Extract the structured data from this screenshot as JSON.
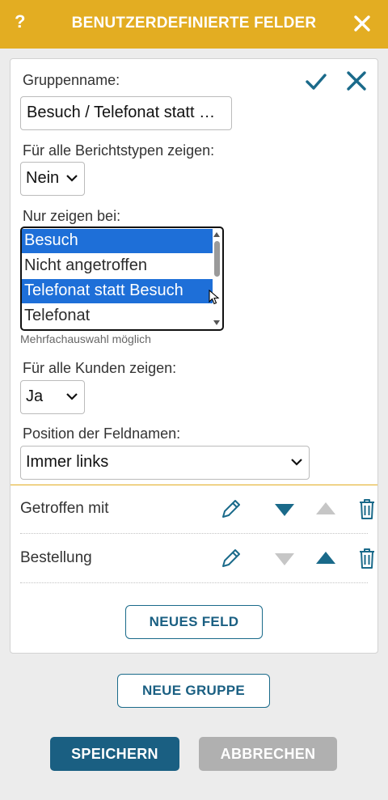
{
  "header": {
    "help_label": "?",
    "title": "BENUTZERDEFINIERTE FELDER",
    "close_icon": "close-icon"
  },
  "group": {
    "name_label": "Gruppenname:",
    "name_value": "Besuch / Telefonat statt Besuch",
    "show_all_types_label": "Für alle Berichtstypen zeigen:",
    "show_all_types_value": "Nein",
    "only_show_label": "Nur zeigen bei:",
    "only_show_options": [
      {
        "label": "Besuch",
        "selected": true
      },
      {
        "label": "Nicht angetroffen",
        "selected": false
      },
      {
        "label": "Telefonat statt Besuch",
        "selected": true
      },
      {
        "label": "Telefonat",
        "selected": false
      }
    ],
    "multi_hint": "Mehrfachauswahl möglich",
    "show_all_customers_label": "Für alle Kunden zeigen:",
    "show_all_customers_value": "Ja",
    "field_name_position_label": "Position der Feldnamen:",
    "field_name_position_value": "Immer links"
  },
  "fields": [
    {
      "name": "Getroffen mit",
      "down_enabled": true,
      "up_enabled": false
    },
    {
      "name": "Bestellung",
      "down_enabled": false,
      "up_enabled": true
    }
  ],
  "buttons": {
    "new_field": "NEUES FELD",
    "new_group": "NEUE GRUPPE",
    "save": "SPEICHERN",
    "cancel": "ABBRECHEN"
  },
  "colors": {
    "header": "#e3ad22",
    "accent": "#1a6a8a",
    "save_bg": "#1a5f82",
    "cancel_bg": "#b0b0b0",
    "selection": "#1e6fd8"
  }
}
